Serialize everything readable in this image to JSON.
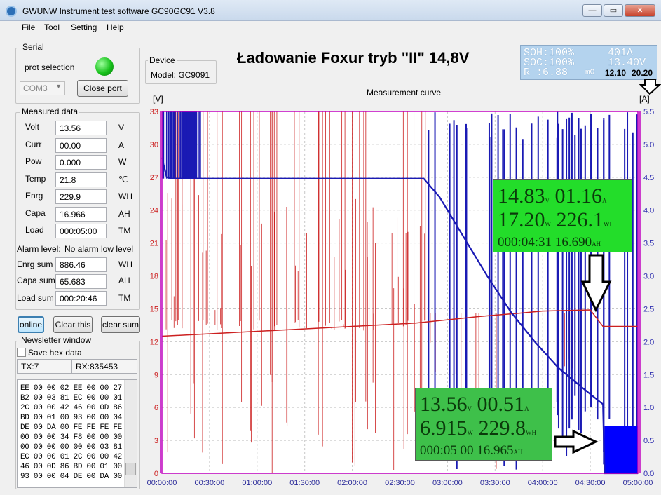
{
  "window": {
    "title": "GWUNW Instrument test software GC90GC91 V3.8",
    "buttons": [
      "—",
      "▭",
      "✕"
    ]
  },
  "menu": [
    "File",
    "Tool",
    "Setting",
    "Help"
  ],
  "serial": {
    "group_label": "Serial",
    "prot_label": "prot selection",
    "port_value": "COM3",
    "close_button": "Close port"
  },
  "device": {
    "group_label": "Device",
    "model": "Model: GC9091"
  },
  "measured": {
    "group_label": "Measured data",
    "rows": [
      {
        "label": "Volt",
        "value": "13.56",
        "unit": "V"
      },
      {
        "label": "Curr",
        "value": "00.00",
        "unit": "A"
      },
      {
        "label": "Pow",
        "value": "0.000",
        "unit": "W"
      },
      {
        "label": "Temp",
        "value": "21.8",
        "unit": "℃"
      },
      {
        "label": "Enrg",
        "value": "229.9",
        "unit": "WH"
      },
      {
        "label": "Capa",
        "value": "16.966",
        "unit": "AH"
      },
      {
        "label": "Load",
        "value": "000:05:00",
        "unit": "TM"
      }
    ],
    "alarm_label": "Alarm level:",
    "alarm_value": "No alarm low level",
    "sums": [
      {
        "label": "Enrg sum",
        "value": "886.46",
        "unit": "WH"
      },
      {
        "label": "Capa sum",
        "value": "65.683",
        "unit": "AH"
      },
      {
        "label": "Load sum",
        "value": "000:20:46",
        "unit": "TM"
      }
    ]
  },
  "actions": {
    "online": "online",
    "clear_this": "Clear this",
    "clear_sum": "clear sum"
  },
  "newsletter": {
    "group_label": "Newsletter window",
    "save_hex": "Save hex data",
    "tx": "TX:7",
    "rx": "RX:835453",
    "lines": [
      "EE 00 00 02 EE 00 00 27",
      "B2 00 03 81 EC 00 00 01",
      "2C 00 00 42 46 00 0D 86",
      "BD 00 01 00 93 00 00 04",
      "DE 00 DA 00 FE FE FE FE",
      "00 00 00 34 F8 00 00 00",
      "00 00 00 00 00 00 03 81",
      "EC 00 00 01 2C 00 00 42",
      "46 00 0D 86 BD 00 01 00",
      "93 00 00 04 DE 00 DA 00"
    ]
  },
  "headline": "Ładowanie Foxur tryb \"II\" 14,8V",
  "lcd": {
    "row1_left": "SOH:100%",
    "row1_right": "401A",
    "row2_left": "SOC:100%",
    "row2_right": "13.40V",
    "row3_left": "R :6.88",
    "row3_unit": "mΩ",
    "bold_left": "12.10",
    "bold_right": "20.20"
  },
  "chart_data": {
    "type": "line",
    "title": "Measurement curve",
    "ylabel_left": "[V]",
    "ylabel_right": "[A]",
    "left_ticks": [
      "0",
      "3",
      "6",
      "9",
      "12",
      "15",
      "18",
      "21",
      "24",
      "27",
      "30",
      "33"
    ],
    "right_ticks": [
      "0.0",
      "0.5",
      "1.0",
      "1.5",
      "2.0",
      "2.5",
      "3.0",
      "3.5",
      "4.0",
      "4.5",
      "5.0",
      "5.5"
    ],
    "x_ticks": [
      "00:00:00",
      "00:30:00",
      "01:00:00",
      "01:30:00",
      "02:00:00",
      "02:30:00",
      "03:00:00",
      "03:30:00",
      "04:00:00",
      "04:30:00",
      "05:00:00"
    ],
    "ylim_left": [
      0,
      33
    ],
    "ylim_right": [
      0,
      5.5
    ],
    "xlim_minutes": [
      0,
      300
    ],
    "grid": true,
    "series": [
      {
        "color": "#cc2020",
        "axis": "left",
        "points": [
          [
            0,
            12.5
          ],
          [
            40,
            12.8
          ],
          [
            80,
            13.1
          ],
          [
            120,
            13.4
          ],
          [
            160,
            13.7
          ],
          [
            180,
            14.0
          ],
          [
            200,
            14.3
          ],
          [
            225,
            14.6
          ],
          [
            240,
            14.8
          ],
          [
            270,
            14.9
          ],
          [
            278,
            13.4
          ],
          [
            300,
            13.4
          ]
        ]
      },
      {
        "color": "#1a1ab4",
        "axis": "right",
        "points": [
          [
            0,
            4.8
          ],
          [
            3,
            4.5
          ],
          [
            6,
            4.48
          ],
          [
            30,
            4.48
          ],
          [
            100,
            4.48
          ],
          [
            165,
            4.48
          ],
          [
            175,
            4.2
          ],
          [
            190,
            3.6
          ],
          [
            205,
            3.0
          ],
          [
            220,
            2.45
          ],
          [
            235,
            2.0
          ],
          [
            250,
            1.6
          ],
          [
            265,
            1.3
          ],
          [
            278,
            1.05
          ],
          [
            279,
            0.0
          ],
          [
            300,
            0.0
          ]
        ]
      }
    ]
  },
  "readings": [
    {
      "l1a": "14.83",
      "l1au": "V",
      "l1b": "01.16",
      "l1bu": "A",
      "l2a": "17.20",
      "l2au": "W",
      "l2b": "226.1",
      "l2bu": "WH",
      "l3a": "000:04:31",
      "l3b": "16.690",
      "l3bu": "AH"
    },
    {
      "l1a": "13.56",
      "l1au": "V",
      "l1b": "00.51",
      "l1bu": "A",
      "l2a": "6.915",
      "l2au": "W",
      "l2b": "229.8",
      "l2bu": "WH",
      "l3a": "000:05 00",
      "l3b": "16.965",
      "l3bu": "AH"
    }
  ],
  "colors": {
    "voltage": "#cc2020",
    "current": "#1a1ab4",
    "plot_border": "#c000c0",
    "reading_bg": "#22dd22"
  }
}
